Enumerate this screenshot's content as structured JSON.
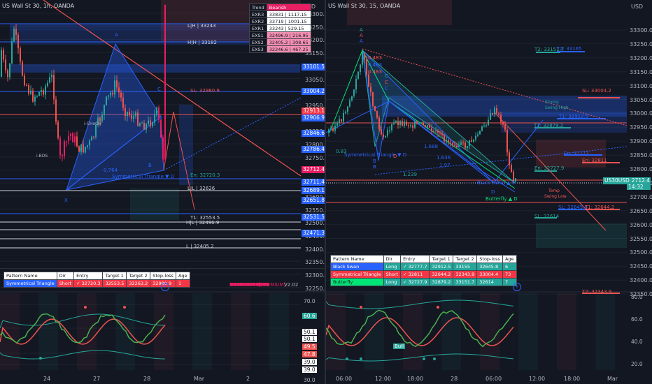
{
  "left": {
    "symbol": "US Wall St 30, 1h, OANDA",
    "currency": "USD",
    "price_axis": [
      "33300.0",
      "33250.0",
      "33200.0",
      "33150.0",
      "33100.0",
      "33050.0",
      "33000.0",
      "32950.0",
      "32900.0",
      "32850.0",
      "32800.0",
      "32750.0",
      "32700.0",
      "32650.0",
      "32600.0",
      "32550.0",
      "32500.0",
      "32450.0",
      "32400.0",
      "32350.0",
      "32300.0",
      "32250.0"
    ],
    "price_tags": [
      {
        "text": "33101.5",
        "bg": "#2962ff"
      },
      {
        "text": "33004.2",
        "bg": "#2962ff"
      },
      {
        "text": "32913.1",
        "bg": "#f23645"
      },
      {
        "text": "32906.9",
        "bg": "#2962ff"
      },
      {
        "text": "32846.6",
        "bg": "#2962ff"
      },
      {
        "text": "32786.4",
        "bg": "#2962ff"
      },
      {
        "text": "32712.4",
        "bg": "#e91e63"
      },
      {
        "text": "32711.4",
        "bg": "#2962ff"
      },
      {
        "text": "32689.1",
        "bg": "#2962ff"
      },
      {
        "text": "32651.8",
        "bg": "#2962ff"
      },
      {
        "text": "32531.5",
        "bg": "#2962ff"
      },
      {
        "text": "32471.3",
        "bg": "#2962ff"
      }
    ],
    "time_axis": [
      "24",
      "27",
      "28",
      "Mar",
      "2"
    ],
    "trend_table": {
      "header": [
        "Trend",
        "Bearish"
      ],
      "rows": [
        [
          "EXR3",
          "33831 | 1117.15"
        ],
        [
          "EXR2",
          "33719 | 1001.15"
        ],
        [
          "EXR1",
          "33243 | 529.15"
        ],
        [
          "EXS1",
          "32496.9 | 216.95"
        ],
        [
          "EXS2",
          "32405.2 | 308.65"
        ],
        [
          "EXS3",
          "32246.6 | 467.25"
        ]
      ]
    },
    "levels": {
      "lh": "L|H | 33243",
      "hh": "H|H | 33182",
      "sl": "SL: 32980.9",
      "en": "En: 32720.3",
      "ll": "L|L | 32626",
      "t1": "T1: 32553.5",
      "hl": "H|L | 32496.9",
      "l": "L | 32405.2",
      "sym_tri": "Symmetrical Triangle ▼ D",
      "ratio": "0.764",
      "x_lbl": "X",
      "a_lbl": "A",
      "b_lbl": "B",
      "c_lbl": "C",
      "premium": "[PREMIUM]",
      "version": "V2.02",
      "i_choch": "i-CHoCH",
      "i_bos": "i-BOS"
    },
    "pattern_table": {
      "headers": [
        "Pattern Name",
        "Dir",
        "Entry",
        "Target 1",
        "Target 2",
        "Stop-loss",
        "Age"
      ],
      "rows": [
        [
          "Symmetrical Triangle",
          "Short",
          "✓ 32720.3",
          "32553.5",
          "32263.2",
          "32980.9",
          "1"
        ]
      ]
    },
    "osc_axis": [
      "70.0",
      "60.6",
      "50.1",
      "50.1",
      "49.5",
      "47.8",
      "39.0",
      "39.0",
      "30.0"
    ]
  },
  "right": {
    "symbol": "US Wall St 30, 15, OANDA",
    "currency": "USD",
    "price_axis": [
      "33300.0",
      "33250.0",
      "33200.0",
      "33150.0",
      "33100.0",
      "33050.0",
      "33000.0",
      "32950.0",
      "32900.0",
      "32850.0",
      "32800.0",
      "32750.0",
      "32700.0",
      "32650.0",
      "32600.0",
      "32550.0",
      "32500.0",
      "32450.0",
      "32400.0",
      "32350.0"
    ],
    "price_tag": {
      "text": "32712.4",
      "sub": "14:32",
      "bg": "#26a69a"
    },
    "ticker_tag": "US30USD",
    "time_axis": [
      "06:00",
      "12:00",
      "18:00",
      "28",
      "06:00",
      "12:00",
      "18:00",
      "Mar"
    ],
    "levels": {
      "t2_a": "T2: 33151.7",
      "t2_b": "T2: 33165",
      "sl_a": "SL: 33004.2",
      "t1_a": "T1: 32912.5",
      "t1_b": "T1: 32879.2",
      "en_a": "En: 32777",
      "en_b": "En: 32811",
      "en_c": "En: 32727.9",
      "sl_b": "SL: 32645.8",
      "t1_c": "T1: 32644.2",
      "sl_c": "SL: 32614",
      "t2_c": "T2: 32343.9",
      "strong": "Strong",
      "swing_high": "Swing High",
      "temp": "Temp",
      "swing_low": "Swing Low",
      "sym_tri": "Symmetrical Triangle ▼ D",
      "black_swan": "Black Swan ▲ D",
      "butterfly": "Butterfly ▲ D",
      "r1": "0.483",
      "r2": "0.483",
      "r3": "0.483",
      "r4": "0.83",
      "r5": "1.688",
      "r6": "1.239",
      "r7": "1.97",
      "r8": "1.636",
      "a1": "A",
      "a2": "A",
      "a3": "A",
      "c1": "C",
      "c2": "C",
      "c3": "C",
      "b1": "B",
      "b2": "B",
      "d1": "D",
      "d2": "D"
    },
    "pattern_table": {
      "headers": [
        "Pattern Name",
        "Dir",
        "Entry",
        "Target 1",
        "Target 2",
        "Stop-loss",
        "Age"
      ],
      "rows": [
        {
          "cells": [
            "Black Swan",
            "Long",
            "✓ 32777.7",
            "32912.5",
            "33155",
            "32645.8",
            "6"
          ],
          "bg": "#2962ff"
        },
        {
          "cells": [
            "Symmetrical Triangle",
            "Short",
            "✓ 32811",
            "32644.2",
            "32343.9",
            "33004.4",
            "73"
          ],
          "bg": "#f23645"
        },
        {
          "cells": [
            "Butterfly",
            "Long",
            "✓ 32727.9",
            "32879.2",
            "33151.7",
            "32614",
            "7"
          ],
          "bg": "#00e676"
        }
      ]
    },
    "osc_axis": [
      "80.0",
      "60.0",
      "40.0",
      "20.0"
    ],
    "osc_label": "Bull"
  },
  "colors": {
    "bg": "#131722",
    "grid": "#1e222d",
    "bull": "#26a69a",
    "bear": "#ef5350",
    "pink": "#e91e63",
    "blue": "#2962ff",
    "white": "#d1d4dc"
  }
}
